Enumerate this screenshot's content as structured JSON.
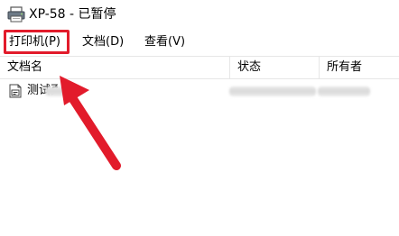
{
  "window": {
    "title": "XP-58 - 已暂停",
    "icon": "printer-icon"
  },
  "menu": {
    "items": [
      {
        "label": "打印机(P)"
      },
      {
        "label": "文档(D)"
      },
      {
        "label": "查看(V)"
      }
    ]
  },
  "list": {
    "columns": [
      {
        "label": "文档名"
      },
      {
        "label": "状态"
      },
      {
        "label": "所有者"
      }
    ],
    "rows": [
      {
        "name": "测试页",
        "icon": "document-icon"
      }
    ]
  },
  "annotation": {
    "color": "#e21b2b",
    "arrow_icon": "arrow-pointer-icon"
  }
}
